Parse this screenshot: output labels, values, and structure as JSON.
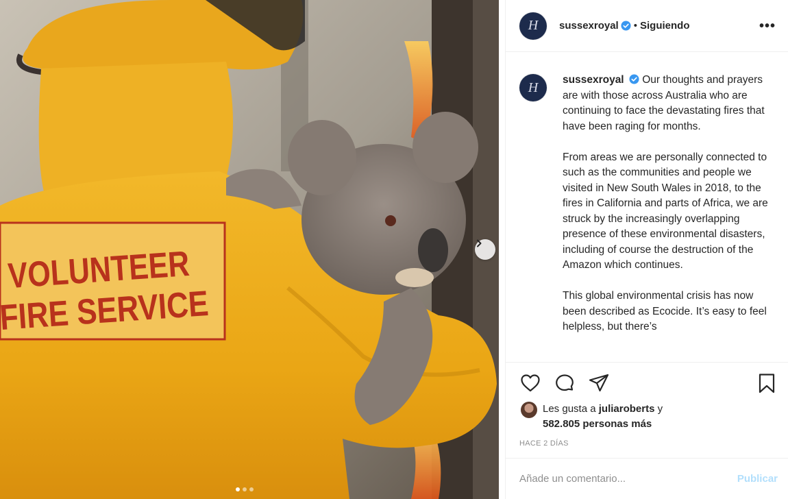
{
  "post": {
    "username": "sussexroyal",
    "avatar_monogram": "H",
    "follow_separator": "•",
    "follow_status": "Siguiendo",
    "more_label": "•••",
    "caption_paragraphs": [
      "Our thoughts and prayers are with those across Australia who are continuing to face the devastating fires that have been raging for months.",
      "From areas we are personally connected to such as the communities and people we visited in New South Wales in 2018, to the fires in California and parts of Africa, we are struck by the increasingly overlapping presence of these environmental disasters, including of course the destruction of the Amazon which continues.",
      "This global environmental crisis has now been described as Ecocide. It’s easy to feel helpless, but there’s"
    ],
    "likes_prefix": "Les gusta a",
    "likes_user": "juliaroberts",
    "likes_conj": "y",
    "likes_others": "582.805 personas más",
    "timestamp": "HACE 2 DÍAS",
    "comment_placeholder": "Añade un comentario...",
    "publish_label": "Publicar"
  },
  "media": {
    "jacket_text_line1": "VOLUNTEER",
    "jacket_text_line2": "FIRE SERVICE",
    "carousel_count": 3,
    "carousel_active": 1
  },
  "colors": {
    "verified": "#3897f0",
    "avatar_bg": "#1d2b4c",
    "jacket": "#f0b320",
    "jacket_text": "#b8321c",
    "publish": "#b2dffc"
  },
  "icons": [
    "verified-icon",
    "more-icon",
    "heart-icon",
    "comment-icon",
    "share-icon",
    "bookmark-icon",
    "chevron-right-icon"
  ]
}
